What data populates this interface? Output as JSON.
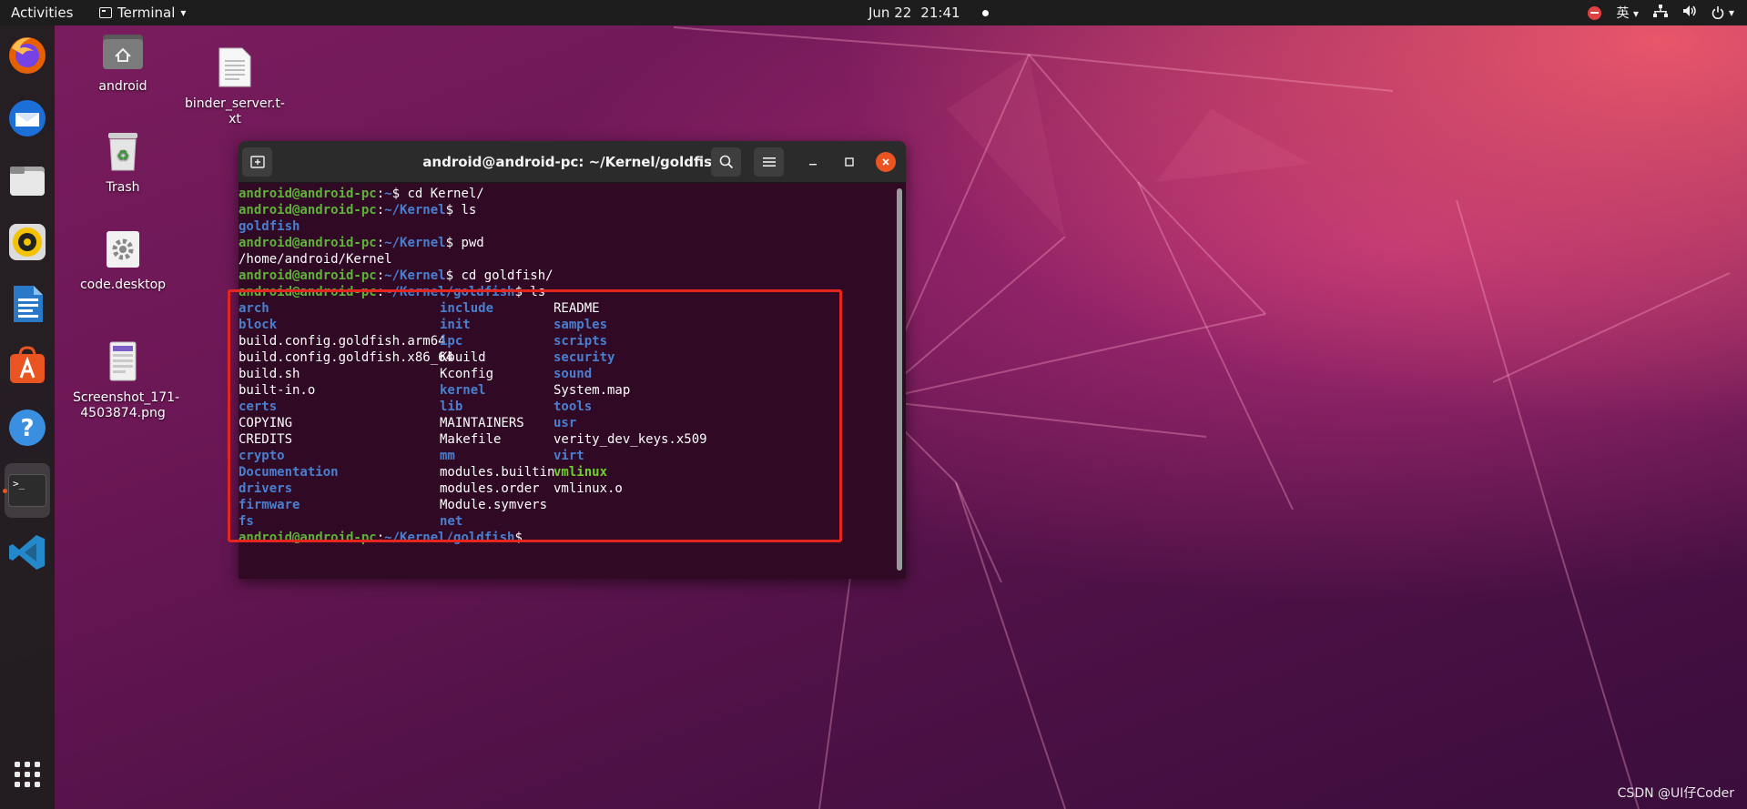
{
  "topbar": {
    "activities": "Activities",
    "app_name": "Terminal",
    "app_menu_arrow": "▾",
    "date": "Jun 22",
    "time": "21:41",
    "input_method": "英",
    "input_arrow": "▾",
    "icons": [
      "stop-icon",
      "network-icon",
      "volume-icon",
      "power-icon"
    ]
  },
  "dock": {
    "items": [
      "firefox-icon",
      "thunderbird-icon",
      "files-icon",
      "rhythmbox-icon",
      "writer-icon",
      "software-icon",
      "help-icon",
      "terminal-icon",
      "vscode-icon",
      "app-grid-icon"
    ],
    "terminal_glyph": ">_"
  },
  "desktop": {
    "icons": [
      {
        "label": "android"
      },
      {
        "label": "binder_server.t-\nxt"
      },
      {
        "label": "Trash"
      },
      {
        "label": "code.desktop"
      },
      {
        "label": "Screenshot_171-\n4503874.png"
      }
    ]
  },
  "terminal": {
    "title": "android@android-pc: ~/Kernel/goldfish",
    "prompt_user": "android@android-pc",
    "lines": [
      {
        "path": "~",
        "cmd": "$ cd Kernel/"
      },
      {
        "path": "~/Kernel",
        "cmd": "$ ls"
      },
      {
        "output": "goldfish",
        "style": "blue"
      },
      {
        "path": "~/Kernel",
        "cmd": "$ pwd"
      },
      {
        "output": "/home/android/Kernel",
        "style": "plain"
      },
      {
        "path": "~/Kernel",
        "cmd": "$ cd goldfish/"
      },
      {
        "path": "~/Kernel/goldfish",
        "cmd": "$ ls"
      }
    ],
    "listing": [
      [
        {
          "t": "arch",
          "s": "blue"
        },
        {
          "t": "include",
          "s": "blue"
        },
        {
          "t": "README",
          "s": "plain"
        }
      ],
      [
        {
          "t": "block",
          "s": "blue"
        },
        {
          "t": "init",
          "s": "blue"
        },
        {
          "t": "samples",
          "s": "blue"
        }
      ],
      [
        {
          "t": "build.config.goldfish.arm64",
          "s": "plain"
        },
        {
          "t": "ipc",
          "s": "blue"
        },
        {
          "t": "scripts",
          "s": "blue"
        }
      ],
      [
        {
          "t": "build.config.goldfish.x86_64",
          "s": "plain"
        },
        {
          "t": "Kbuild",
          "s": "plain"
        },
        {
          "t": "security",
          "s": "blue"
        }
      ],
      [
        {
          "t": "build.sh",
          "s": "plain"
        },
        {
          "t": "Kconfig",
          "s": "plain"
        },
        {
          "t": "sound",
          "s": "blue"
        }
      ],
      [
        {
          "t": "built-in.o",
          "s": "plain"
        },
        {
          "t": "kernel",
          "s": "blue"
        },
        {
          "t": "System.map",
          "s": "plain"
        }
      ],
      [
        {
          "t": "certs",
          "s": "blue"
        },
        {
          "t": "lib",
          "s": "blue"
        },
        {
          "t": "tools",
          "s": "blue"
        }
      ],
      [
        {
          "t": "COPYING",
          "s": "plain"
        },
        {
          "t": "MAINTAINERS",
          "s": "plain"
        },
        {
          "t": "usr",
          "s": "blue"
        }
      ],
      [
        {
          "t": "CREDITS",
          "s": "plain"
        },
        {
          "t": "Makefile",
          "s": "plain"
        },
        {
          "t": "verity_dev_keys.x509",
          "s": "plain"
        }
      ],
      [
        {
          "t": "crypto",
          "s": "blue"
        },
        {
          "t": "mm",
          "s": "blue"
        },
        {
          "t": "virt",
          "s": "blue"
        }
      ],
      [
        {
          "t": "Documentation",
          "s": "blue"
        },
        {
          "t": "modules.builtin",
          "s": "plain"
        },
        {
          "t": "vmlinux",
          "s": "bin"
        }
      ],
      [
        {
          "t": "drivers",
          "s": "blue"
        },
        {
          "t": "modules.order",
          "s": "plain"
        },
        {
          "t": "vmlinux.o",
          "s": "plain"
        }
      ],
      [
        {
          "t": "firmware",
          "s": "blue"
        },
        {
          "t": "Module.symvers",
          "s": "plain"
        },
        {
          "t": "",
          "s": "plain"
        }
      ],
      [
        {
          "t": "fs",
          "s": "blue"
        },
        {
          "t": "net",
          "s": "blue"
        },
        {
          "t": "",
          "s": "plain"
        }
      ]
    ],
    "final_prompt": {
      "path": "~/Kernel/goldfish",
      "cmd": "$"
    }
  },
  "colors": {
    "accent": "#e95420",
    "prompt_green": "#5fb23a",
    "dir_blue": "#4a7fd0",
    "highlight_red": "#e5261f",
    "terminal_bg": "#300a24"
  },
  "watermark": "CSDN @UI仔Coder"
}
